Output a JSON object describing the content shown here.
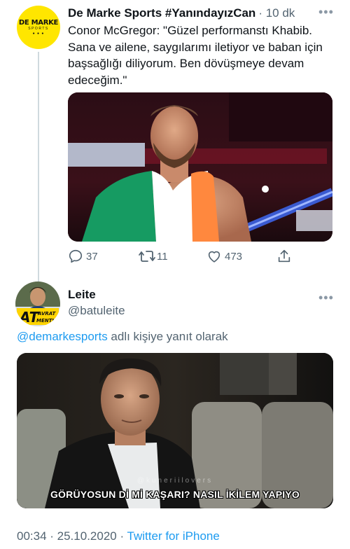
{
  "tweet1": {
    "avatar": {
      "logo_text": "DE MARKE",
      "logo_subtext": "SPORTS"
    },
    "author_name": "De Marke Sports #YanındayızCan",
    "time_ago": "10 dk",
    "text": "Conor McGregor: \"Güzel performanstı Khabib. Sana ve ailene, saygılarımı iletiyor ve baban için başsağlığı diliyorum. Ben dövüşmeye devam edeceğim.\"",
    "media_icon": "fighter-photo",
    "actions": {
      "reply_count": "37",
      "retweet_count": "11",
      "like_count": "473"
    }
  },
  "tweet2": {
    "avatar": {
      "text_top": "AT",
      "text_side1": "AVRAT",
      "text_side2": "MENTION"
    },
    "author_name": "Leite",
    "handle": "@batuleite",
    "reply_to_mention": "@demarkesports",
    "reply_to_suffix": " adlı kişiye yanıt olarak",
    "media": {
      "watermark": "@kuneriilovers",
      "caption": "GÖRÜYOSUN Dİ Mİ KAŞARI? NASIL İKİLEM YAPIYO"
    },
    "timestamp": "00:34 · 25.10.2020 · ",
    "source": "Twitter for iPhone"
  },
  "colors": {
    "accent": "#1d9bf0",
    "secondary_text": "#536471",
    "thread_line": "#cfd9de",
    "avatar_yellow": "#ffe600"
  }
}
